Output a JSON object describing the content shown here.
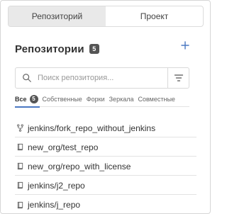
{
  "toggle": {
    "repo_label": "Репозиторий",
    "project_label": "Проект",
    "active": "repo"
  },
  "section": {
    "title": "Репозитории",
    "count": "5"
  },
  "search": {
    "placeholder": "Поиск репозитория...",
    "value": ""
  },
  "filter_tabs": [
    {
      "label": "Все",
      "count": "5",
      "active": true
    },
    {
      "label": "Собственные"
    },
    {
      "label": "Форки"
    },
    {
      "label": "Зеркала"
    },
    {
      "label": "Совместные"
    }
  ],
  "repos": [
    {
      "name": "jenkins/fork_repo_without_jenkins",
      "icon": "fork-icon"
    },
    {
      "name": "new_org/test_repo",
      "icon": "repo-icon"
    },
    {
      "name": "new_org/repo_with_license",
      "icon": "repo-icon"
    },
    {
      "name": "jenkins/j2_repo",
      "icon": "repo-icon"
    },
    {
      "name": "jenkins/j_repo",
      "icon": "repo-icon"
    }
  ],
  "colors": {
    "accent": "#4a78c2",
    "badge": "#555555",
    "active_toggle": "#e9e9e9"
  }
}
